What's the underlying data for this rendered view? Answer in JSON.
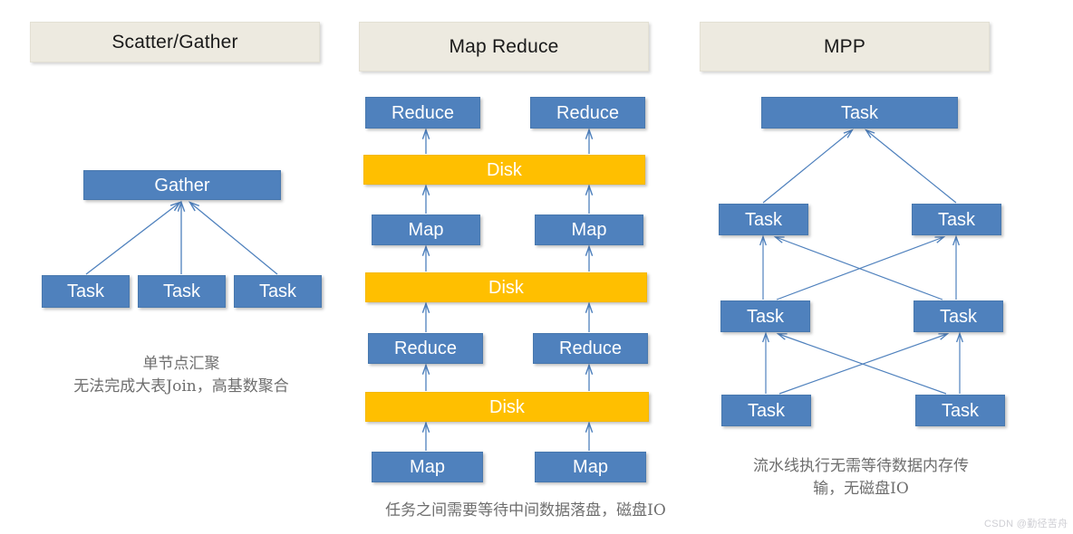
{
  "diagram": {
    "title_bar_color": "#EDEAE0",
    "node_blue": "#4F81BD",
    "node_orange": "#FFBF00",
    "arrow_color": "#4F81BD"
  },
  "columns": [
    {
      "id": "scatter-gather",
      "header": "Scatter/Gather",
      "nodes": [
        {
          "label": "Gather",
          "kind": "blue"
        },
        {
          "label": "Task",
          "kind": "blue"
        },
        {
          "label": "Task",
          "kind": "blue"
        },
        {
          "label": "Task",
          "kind": "blue"
        }
      ],
      "caption_line1": "单节点汇聚",
      "caption_line2": "无法完成大表Join，高基数聚合"
    },
    {
      "id": "map-reduce",
      "header": "Map Reduce",
      "nodes": [
        {
          "label": "Reduce",
          "kind": "blue"
        },
        {
          "label": "Reduce",
          "kind": "blue"
        },
        {
          "label": "Disk",
          "kind": "orange"
        },
        {
          "label": "Map",
          "kind": "blue"
        },
        {
          "label": "Map",
          "kind": "blue"
        },
        {
          "label": "Disk",
          "kind": "orange"
        },
        {
          "label": "Reduce",
          "kind": "blue"
        },
        {
          "label": "Reduce",
          "kind": "blue"
        },
        {
          "label": "Disk",
          "kind": "orange"
        },
        {
          "label": "Map",
          "kind": "blue"
        },
        {
          "label": "Map",
          "kind": "blue"
        }
      ],
      "caption_line1": "任务之间需要等待中间数据落盘，磁盘IO"
    },
    {
      "id": "mpp",
      "header": "MPP",
      "nodes": [
        {
          "label": "Task",
          "kind": "blue"
        },
        {
          "label": "Task",
          "kind": "blue"
        },
        {
          "label": "Task",
          "kind": "blue"
        },
        {
          "label": "Task",
          "kind": "blue"
        },
        {
          "label": "Task",
          "kind": "blue"
        },
        {
          "label": "Task",
          "kind": "blue"
        },
        {
          "label": "Task",
          "kind": "blue"
        }
      ],
      "caption_line1": "流水线执行无需等待数据内存传",
      "caption_line2": "输，无磁盘IO"
    }
  ],
  "watermark": "CSDN @勤径苦舟"
}
